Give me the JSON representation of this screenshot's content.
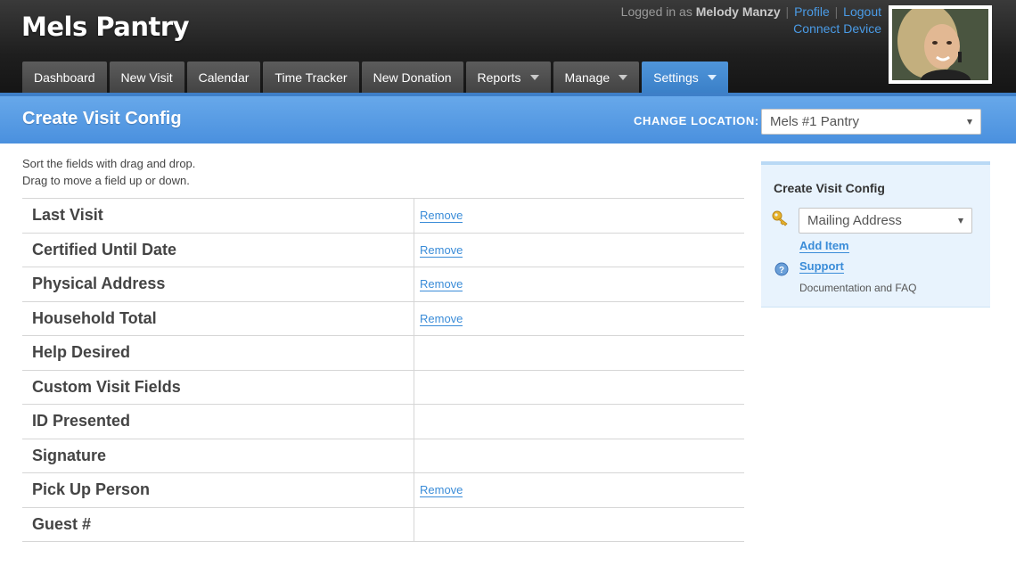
{
  "app": {
    "title": "Mels Pantry"
  },
  "user": {
    "logged_in_as": "Logged in as",
    "name": "Melody Manzy",
    "profile_link": "Profile",
    "logout_link": "Logout",
    "separator": "|",
    "connect_device": "Connect Device"
  },
  "nav": {
    "tabs": [
      {
        "label": "Dashboard",
        "dropdown": false
      },
      {
        "label": "New Visit",
        "dropdown": false
      },
      {
        "label": "Calendar",
        "dropdown": false
      },
      {
        "label": "Time Tracker",
        "dropdown": false
      },
      {
        "label": "New Donation",
        "dropdown": false
      },
      {
        "label": "Reports",
        "dropdown": true
      },
      {
        "label": "Manage",
        "dropdown": true
      },
      {
        "label": "Settings",
        "dropdown": true,
        "active": true
      }
    ]
  },
  "page": {
    "title": "Create Visit Config",
    "location_label": "CHANGE LOCATION:",
    "location_value": "Mels #1 Pantry",
    "instructions": [
      "Sort the fields with drag and drop.",
      "Drag to move a field up or down."
    ]
  },
  "fields": [
    {
      "name": "Last Visit",
      "action": "Remove"
    },
    {
      "name": "Certified Until Date",
      "action": "Remove"
    },
    {
      "name": "Physical Address",
      "action": "Remove"
    },
    {
      "name": "Household Total",
      "action": "Remove"
    },
    {
      "name": "Help Desired",
      "action": ""
    },
    {
      "name": "Custom Visit Fields",
      "action": ""
    },
    {
      "name": "ID Presented",
      "action": ""
    },
    {
      "name": "Signature",
      "action": ""
    },
    {
      "name": "Pick Up Person",
      "action": "Remove"
    },
    {
      "name": "Guest #",
      "action": ""
    }
  ],
  "sidebar": {
    "title": "Create Visit Config",
    "select_value": "Mailing Address",
    "add_item": "Add Item",
    "support": "Support",
    "support_desc": "Documentation and FAQ",
    "key_icon": "key-icon",
    "help_icon": "help-icon"
  },
  "colors": {
    "header_bg": "#1e1e1e",
    "nav_tab": "#4f4f4f",
    "nav_active": "#3b80c8",
    "title_bar": "#4a90de",
    "link": "#3a8cd8",
    "sidebar_bg": "#e8f3fd"
  }
}
